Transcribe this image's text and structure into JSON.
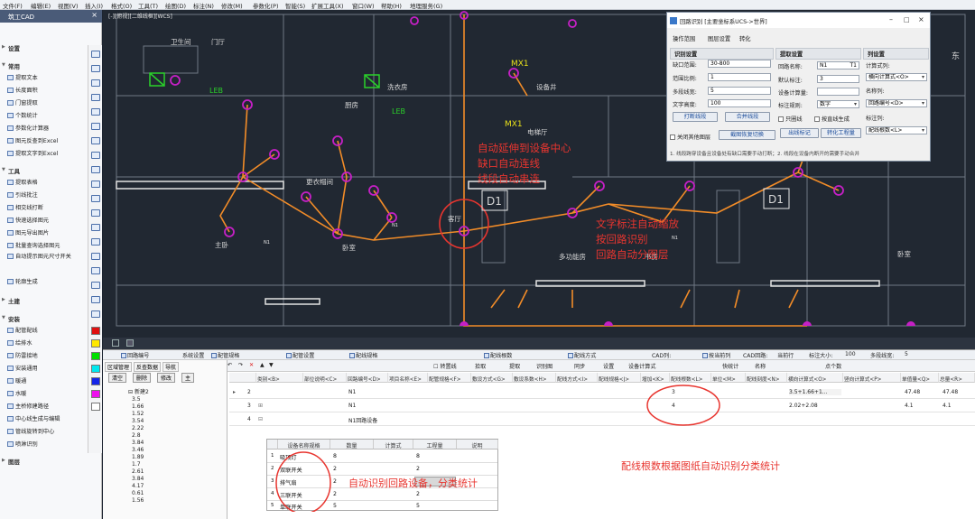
{
  "menubar": {
    "items": [
      "文件(F)",
      "编辑(E)",
      "视图(V)",
      "插入(I)",
      "格式(O)",
      "工具(T)",
      "绘图(D)",
      "标注(N)",
      "修改(M)",
      "参数化(P)",
      "智能(S)",
      "扩展工具(X)",
      "窗口(W)",
      "帮助(H)",
      "地理服务(G)"
    ]
  },
  "left_panel": {
    "title": "筑工CAD",
    "close": "×",
    "groups": {
      "settings": "设置",
      "common": "常用",
      "tools": "工具",
      "civil": "土建",
      "install": "安装",
      "layers": "图层"
    },
    "common_items": [
      "提取文本",
      "长度面积",
      "门窗提取",
      "个数统计",
      "参数化计算器",
      "图元反查到Excel",
      "提取文字到Excel"
    ],
    "tool_items": [
      "提取表格",
      "引线批注",
      "相交线打断",
      "快速选择图元",
      "图元导出图片",
      "批量查询选择图元",
      "自动提示图元尺寸开关",
      "轮廓生成"
    ],
    "install_items": [
      "配管配线",
      "给排水",
      "防雷接地",
      "安装通用",
      "暖通",
      "水暖",
      "主桥修建路径",
      "中心线生成与编辑",
      "管线旋转到中心",
      "喷淋识别"
    ]
  },
  "cad": {
    "view_label": "[-][俯视][二维线框][WCS]",
    "room_labels": [
      "主卧",
      "客厅",
      "更衣帽间",
      "卧室",
      "卫生间",
      "厨房",
      "多功能房",
      "书房",
      "洗衣房",
      "门厅",
      "电梯厅",
      "设备井"
    ],
    "sheet_marks": [
      "D1",
      "D1"
    ],
    "device_tags": [
      "LEB",
      "LEB",
      "MX1",
      "MX1"
    ],
    "circuit_label": "N1",
    "compass": "东"
  },
  "annotations": {
    "a1": [
      "自动延伸到设备中心",
      "缺口自动连线",
      "线段自动串连"
    ],
    "a2": [
      "文字标注自动缩放",
      "按回路识别",
      "回路自动分图层"
    ],
    "a3": "配线根数根据图纸自动识别分类统计",
    "a4": "自动识别回路设备，分类统计"
  },
  "dialog": {
    "title": "回路识别 [主要坐标系UCS->世界]",
    "menu": [
      "操作范围",
      "图层设置",
      "转化"
    ],
    "sec_recognize": "识别设置",
    "gap_label": "缺口范围:",
    "gap_value": "30-800",
    "ratio_label": "范围比例:",
    "ratio_value": "1",
    "multi_label": "多段线宽:",
    "multi_value": "5",
    "text_height_label": "文字高度:",
    "text_height_value": "100",
    "btn_break": "打断线段",
    "btn_merge": "合并线段",
    "chk_close_other": "关闭其他图层",
    "btn_recover": "截图恢复切换",
    "sec_extract": "提取设置",
    "circuit_name_label": "回路名称:",
    "circuit_name_value": "N1",
    "circuit_name_suffix": "T1",
    "default_mark_label": "默认标注:",
    "default_mark_value": "3",
    "device_count_label": "设备计算量:",
    "mark_rule_label": "标注规则:",
    "mark_rule_value": "数字",
    "chk_only_circle": "只圈线",
    "chk_by_dir": "按直线生成",
    "btn_out_mark": "出线标记",
    "btn_convert": "转化工程量",
    "sec_columns": "列设置",
    "calc_col_label": "计算式列:",
    "calc_col_value": "横向计算式<O>",
    "name_col_label": "名称列:",
    "name_col_value": "回路编号<D>",
    "mark_col_label": "标注列:",
    "mark_col_value": "配线根数<L>",
    "note": "1. 线段跨穿设备且设备处有缺口需要手动打断；2. 线段在设备内断开的需要手动合并"
  },
  "bottom": {
    "field_bar": [
      "回路编号",
      "系统设置",
      "配管规格",
      "配管设置",
      "配线规格",
      "配线根数",
      "配线方式",
      "CAD列:",
      "按当前列",
      "CAD回路:",
      "当前行",
      "标注大小:",
      "100",
      "多段线宽:",
      "5"
    ],
    "tool_bar": [
      "转置线",
      "拾取",
      "提取",
      "识别图",
      "同步",
      "设置",
      "设备计算式",
      "快统计",
      "名称",
      "点个数"
    ],
    "left_tabs": [
      "区域管理",
      "反查数据",
      "导航"
    ],
    "left_btns": [
      "清空",
      "删除",
      "修改",
      "主"
    ],
    "tree_root": "新建2",
    "tree_items": [
      "3.5",
      "1.66",
      "1.52",
      "3.54",
      "2.22",
      "2.8",
      "3.84",
      "3.46",
      "1.89",
      "1.7",
      "2.61",
      "3.84",
      "4.17",
      "0.61",
      "1.56"
    ],
    "headers": [
      "类别<B>",
      "部位说明<C>",
      "回路编号<D>",
      "项目名称<E>",
      "配管规格<F>",
      "敷设方式<G>",
      "敷设系数<H>",
      "配线方式<I>",
      "配线规格<J>",
      "增加<K>",
      "配线根数<L>",
      "单位<M>",
      "配线刻度<N>",
      "横向计算式<O>",
      "竖向计算式<P>",
      "单值量<Q>",
      "总量<R>"
    ],
    "rows": [
      {
        "num": "2",
        "circuit": "N1",
        "count": "3",
        "formula": "3.5+1.66+1...",
        "unit_qty": "47.48",
        "total": "47.48"
      },
      {
        "num": "3",
        "circuit": "N1",
        "count": "4",
        "formula": "2.02+2.08",
        "unit_qty": "4.1",
        "total": "4.1"
      },
      {
        "num": "4",
        "circuit": "N1回路设备",
        "count": "",
        "formula": "",
        "unit_qty": "",
        "total": ""
      }
    ],
    "sub_headers": [
      "设备名称规格",
      "数量",
      "计算式",
      "工程量",
      "说明"
    ],
    "sub_rows": [
      {
        "n": "1",
        "name": "吸顶灯",
        "qty": "8",
        "calc": "",
        "total": "8"
      },
      {
        "n": "2",
        "name": "双联开关",
        "qty": "2",
        "calc": "",
        "total": "2"
      },
      {
        "n": "3",
        "name": "排气扇",
        "qty": "2",
        "calc": "",
        "total": ""
      },
      {
        "n": "4",
        "name": "三联开关",
        "qty": "2",
        "calc": "",
        "total": "2"
      },
      {
        "n": "5",
        "name": "单联开关",
        "qty": "5",
        "calc": "",
        "total": "5"
      }
    ]
  }
}
